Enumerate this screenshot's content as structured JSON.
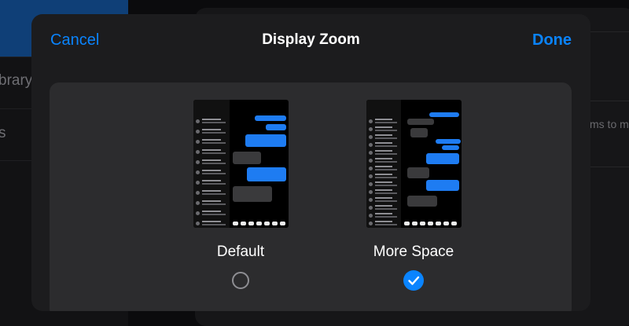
{
  "background": {
    "sidebar_items": [
      "brary",
      "s"
    ],
    "main_text": "ms to m"
  },
  "sheet": {
    "cancel_label": "Cancel",
    "title": "Display Zoom",
    "done_label": "Done"
  },
  "options": [
    {
      "label": "Default",
      "selected": false
    },
    {
      "label": "More Space",
      "selected": true
    }
  ],
  "colors": {
    "accent": "#0a84ff",
    "sheet_bg": "#1c1c1e",
    "card_bg": "#2c2c2e"
  },
  "icons": [
    "radio-unselected-icon",
    "checkmark-circle-icon"
  ]
}
